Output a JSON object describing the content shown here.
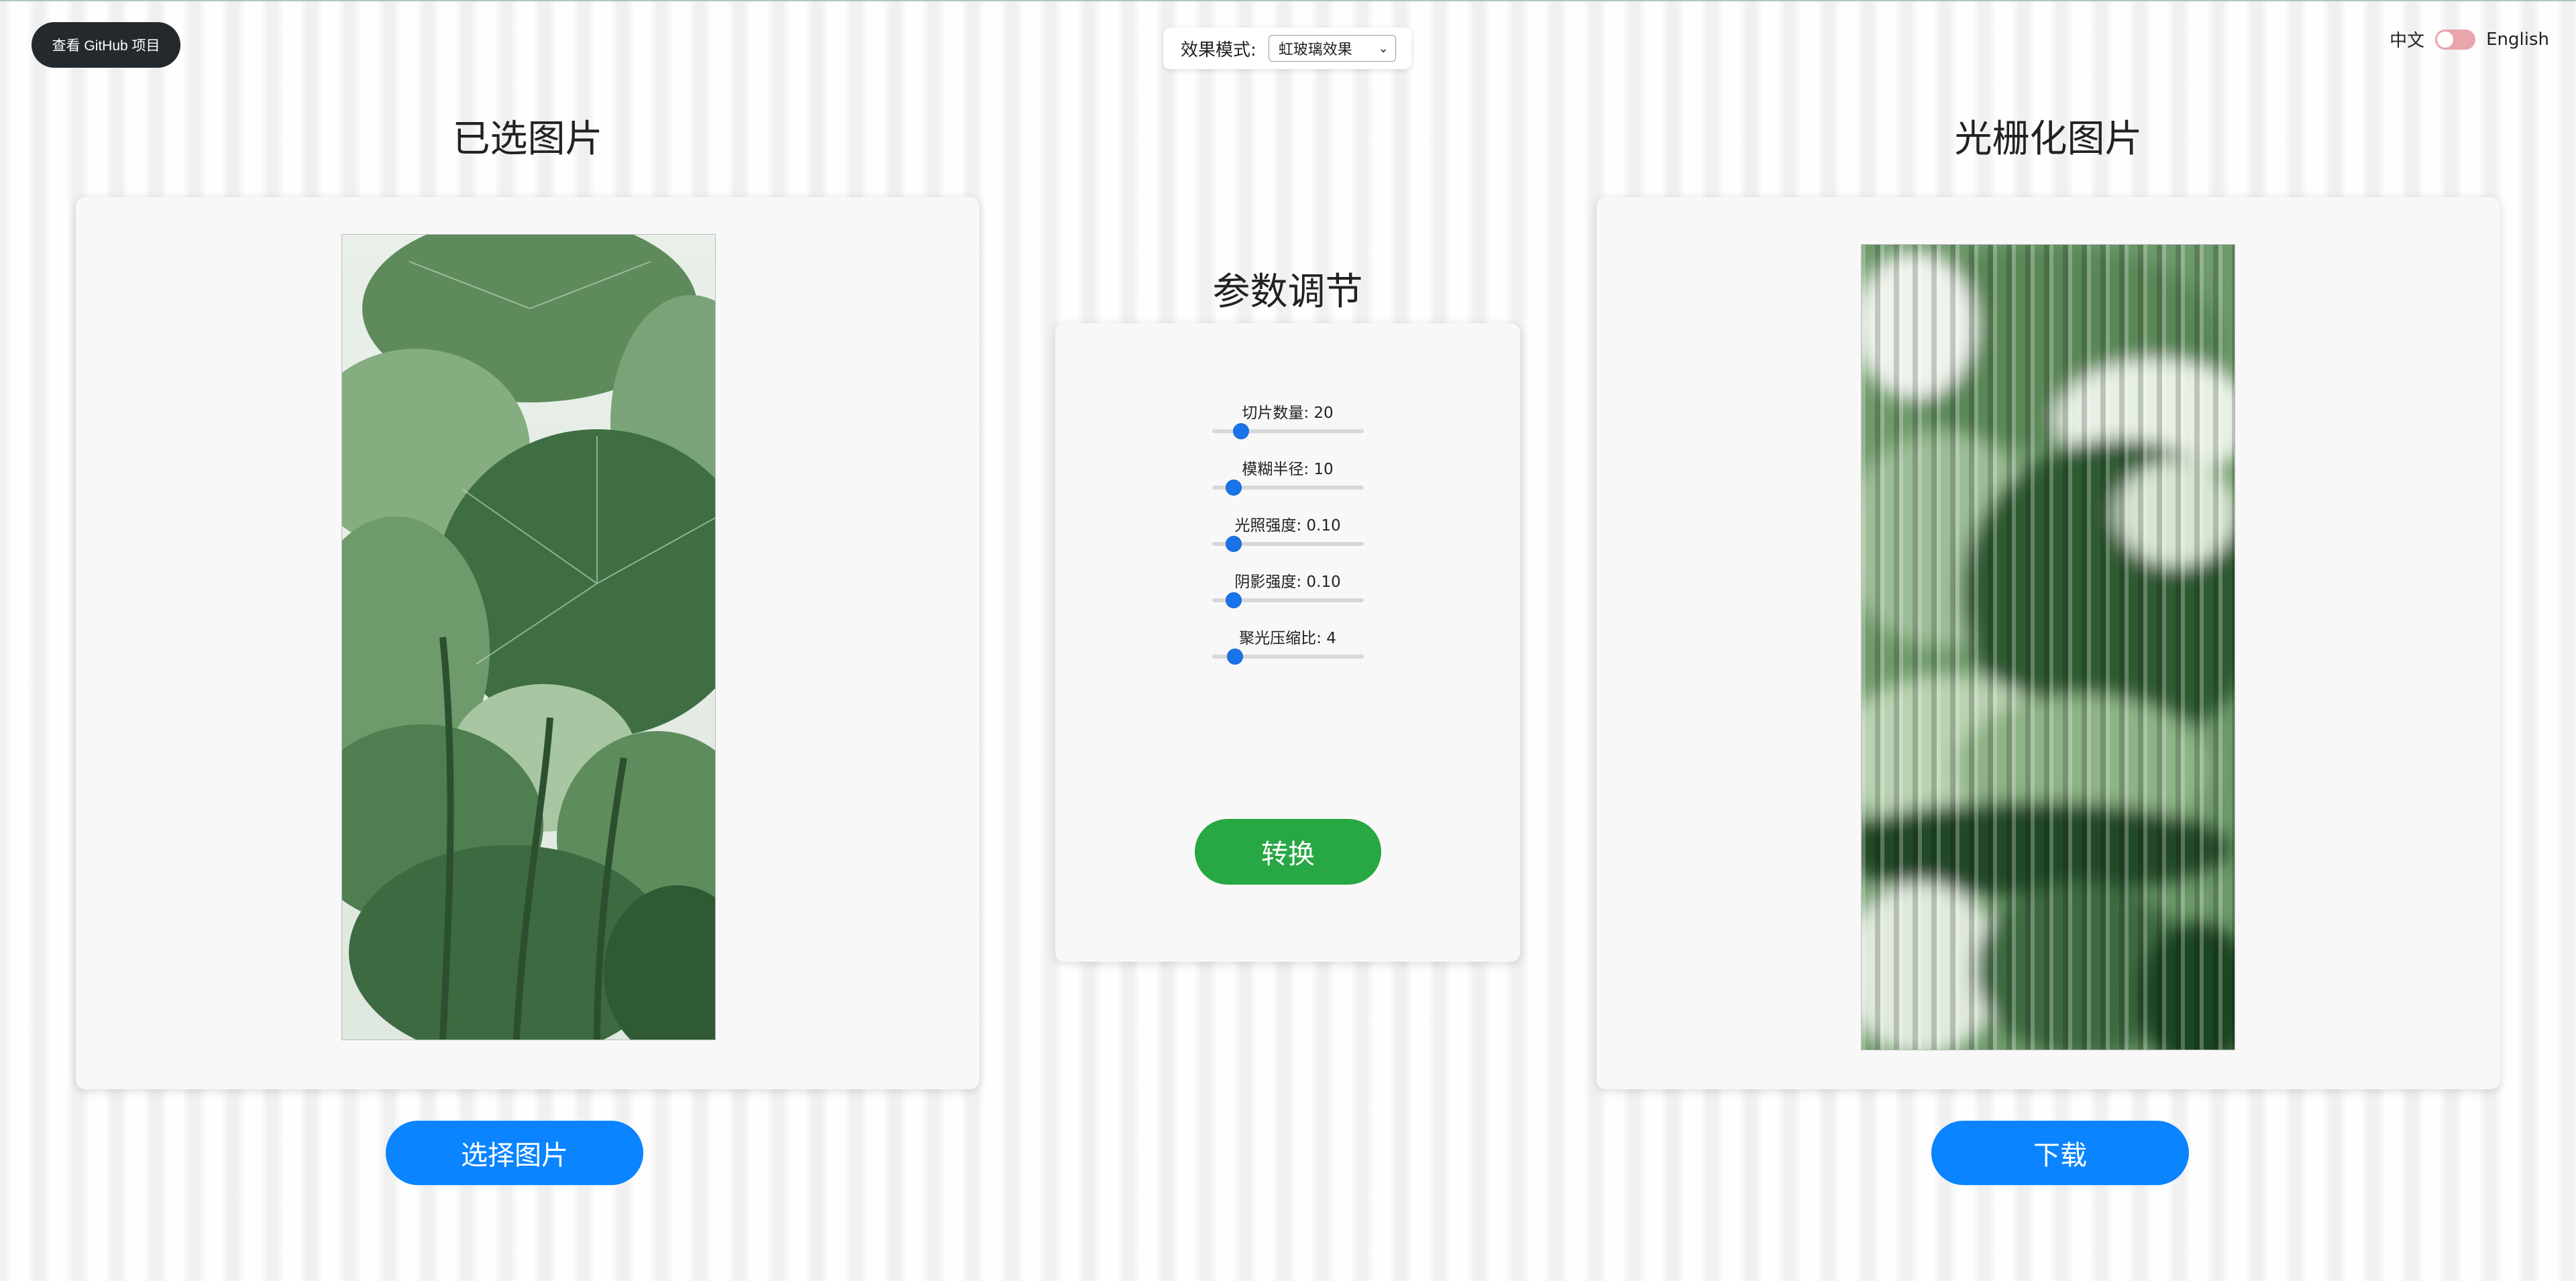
{
  "header": {
    "github_label": "查看 GitHub 项目",
    "mode_label": "效果模式:",
    "mode_value": "虹玻璃效果",
    "lang_zh": "中文",
    "lang_en": "English"
  },
  "left": {
    "title": "已选图片",
    "button": "选择图片"
  },
  "right": {
    "title": "光栅化图片",
    "button": "下载"
  },
  "params": {
    "title": "参数调节",
    "sliders": [
      {
        "label": "切片数量: 20",
        "level": 0.2
      },
      {
        "label": "模糊半径: 10",
        "level": 0.1
      },
      {
        "label": "光照强度: 0.10",
        "level": 0.1
      },
      {
        "label": "阴影强度: 0.10",
        "level": 0.1
      },
      {
        "label": "聚光压缩比: 4",
        "level": 0.11
      }
    ],
    "convert": "转换"
  },
  "colors": {
    "github_bg": "#24292e",
    "primary": "#0a84ff",
    "convert": "#28a745",
    "slider_thumb": "#1a73e8",
    "toggle": "#e8a6aa"
  }
}
